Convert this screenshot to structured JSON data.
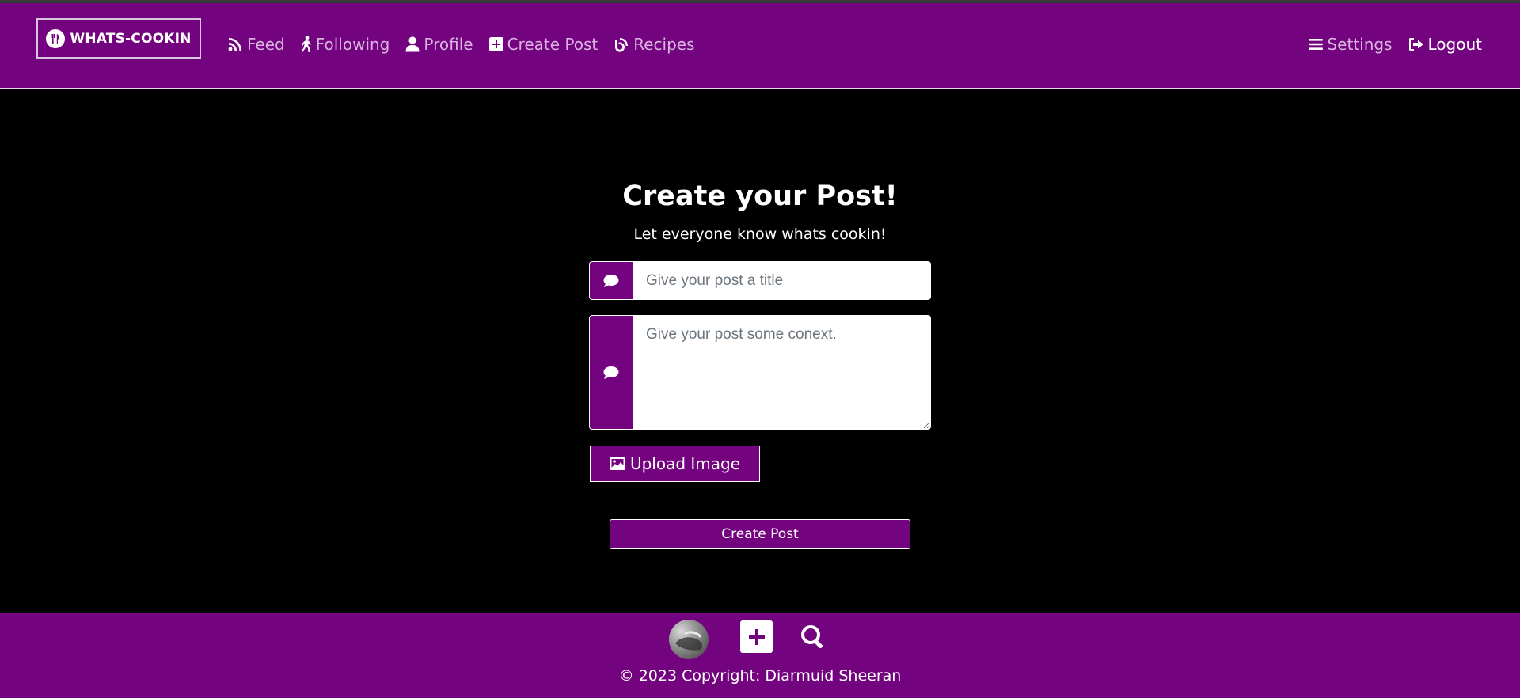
{
  "brand": {
    "name": "WHATS-COOKIN"
  },
  "nav": {
    "left": [
      {
        "label": "Feed",
        "icon": "rss-icon"
      },
      {
        "label": "Following",
        "icon": "walking-icon"
      },
      {
        "label": "Profile",
        "icon": "user-icon"
      },
      {
        "label": "Create Post",
        "icon": "plus-square-icon"
      },
      {
        "label": "Recipes",
        "icon": "blog-icon"
      }
    ],
    "right": [
      {
        "label": "Settings",
        "icon": "bars-icon"
      },
      {
        "label": "Logout",
        "icon": "sign-out-icon"
      }
    ]
  },
  "main": {
    "title": "Create your Post!",
    "subtitle": "Let everyone know whats cookin!",
    "title_input": {
      "placeholder": "Give your post a title",
      "value": ""
    },
    "context_input": {
      "placeholder": "Give your post some conext.",
      "value": ""
    },
    "upload_label": "Upload Image",
    "create_label": "Create Post"
  },
  "footer": {
    "copyright": "© 2023 Copyright: Diarmuid Sheeran"
  },
  "colors": {
    "brand_purple": "#74037f",
    "nav_link": "#d8b4df",
    "background": "#000000"
  }
}
